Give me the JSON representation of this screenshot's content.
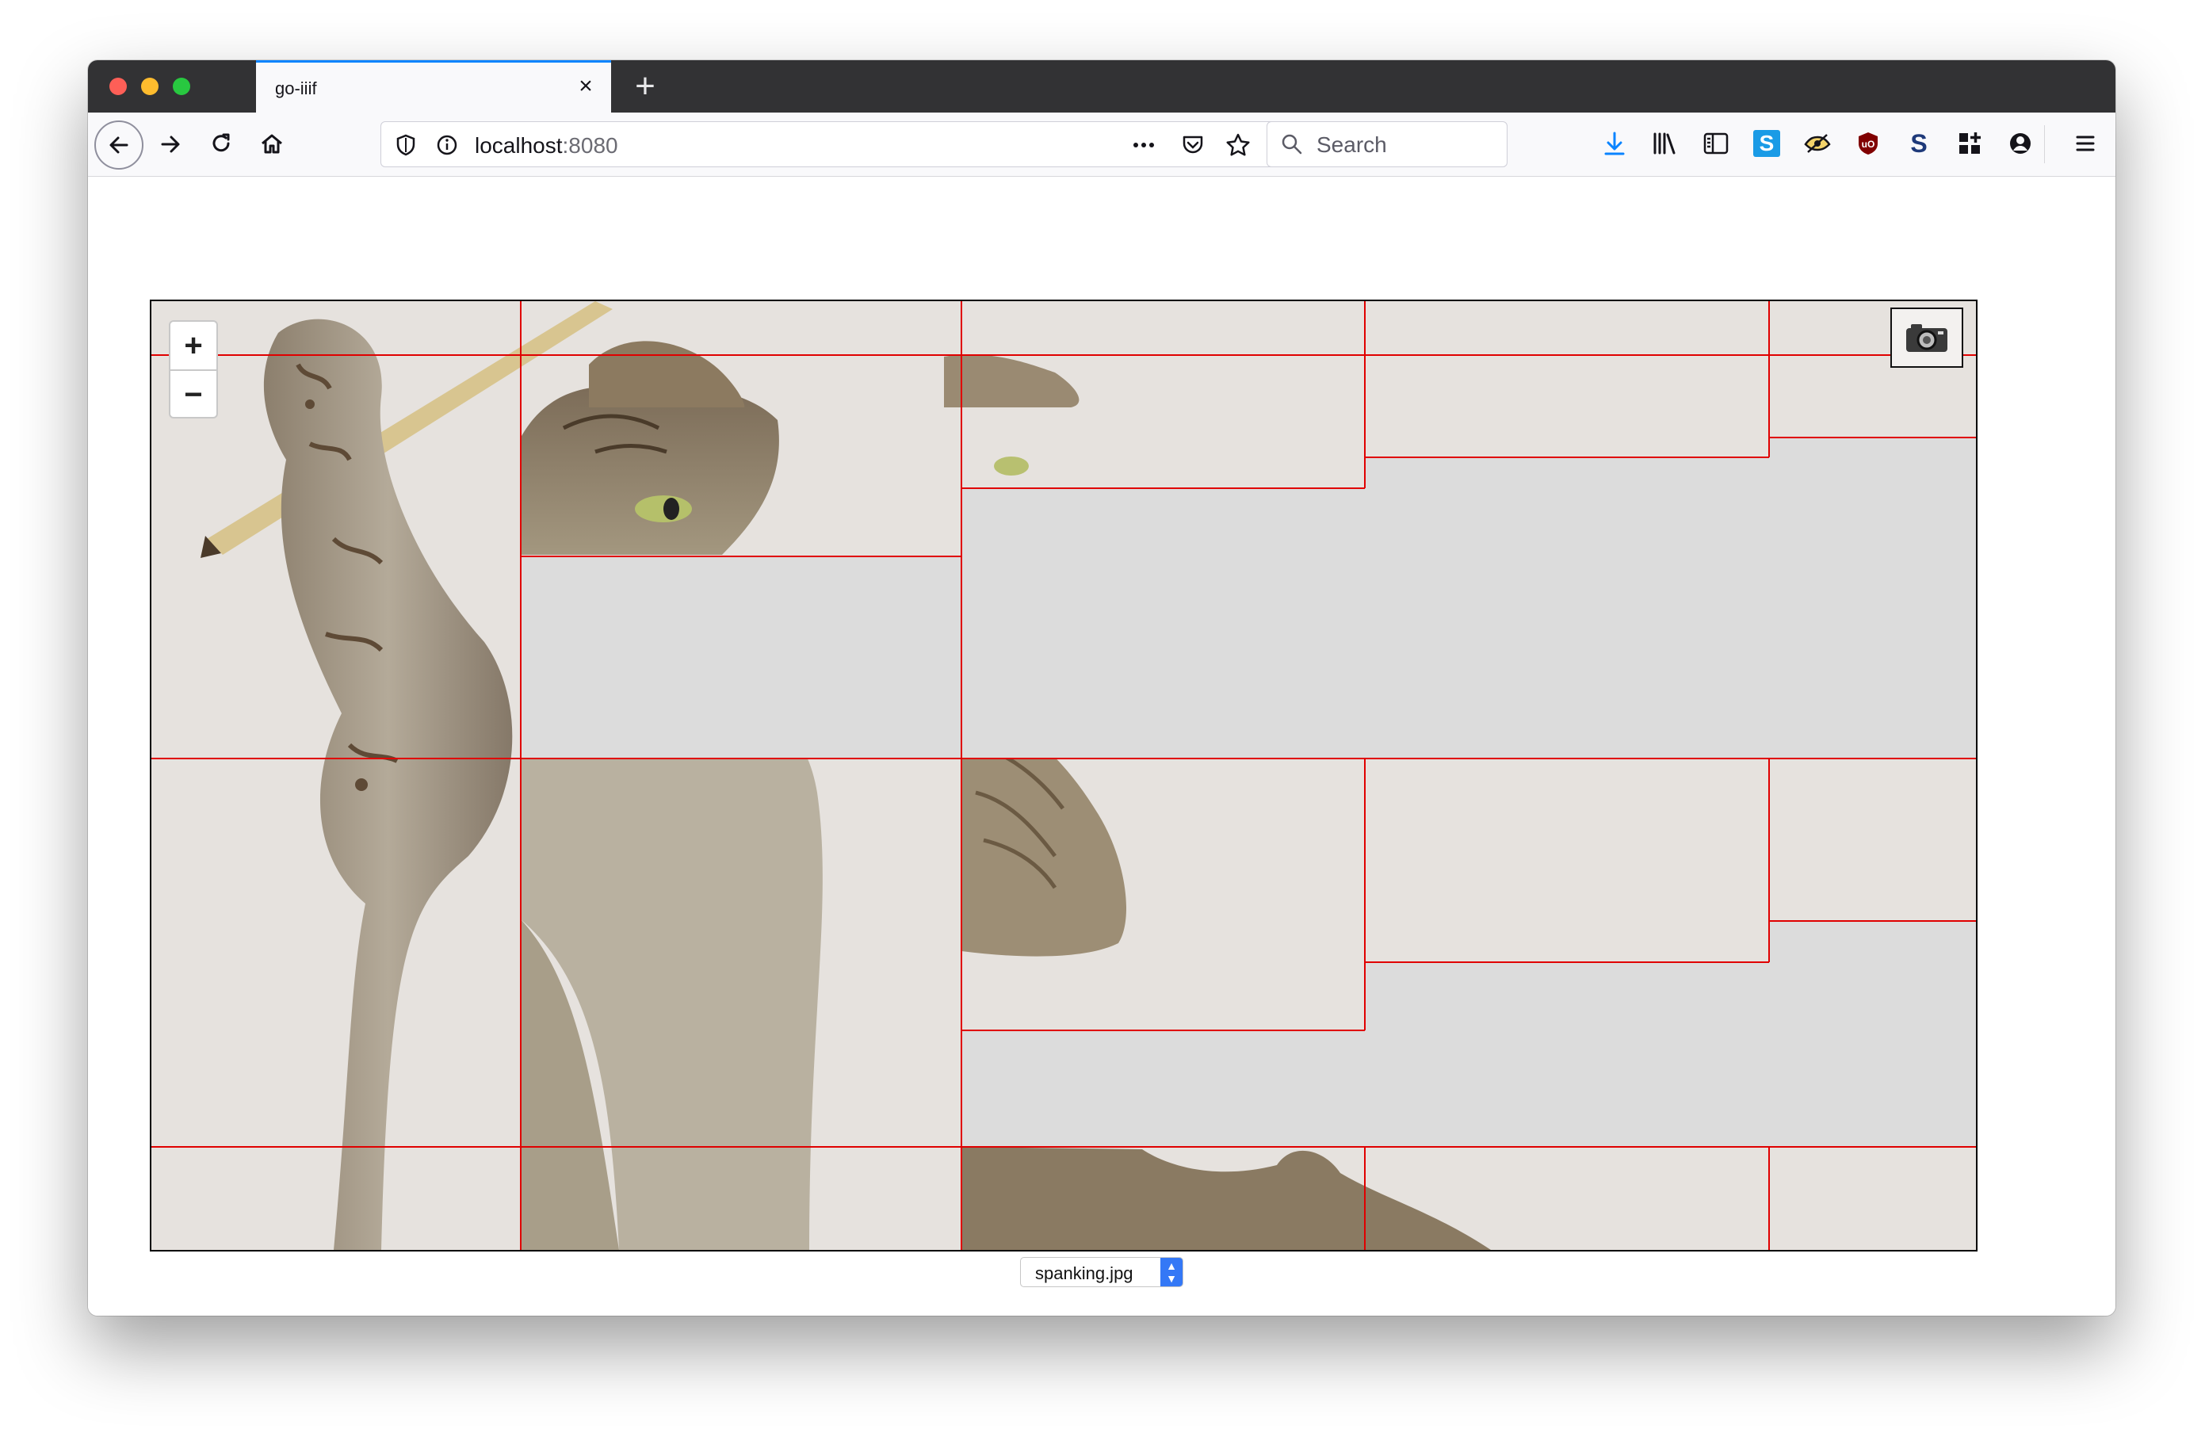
{
  "browser": {
    "tab_title": "go-iiif",
    "url_host": "localhost",
    "url_port": ":8080",
    "search_placeholder": "Search",
    "toolbar_icons": [
      "download-icon",
      "library-icon",
      "sidebar-icon",
      "s-extension-icon",
      "eye-extension-icon",
      "ublock-icon",
      "s-bold-icon",
      "extensions-grid-icon",
      "account-icon",
      "menu-icon"
    ]
  },
  "viewer": {
    "zoom_in_label": "+",
    "zoom_out_label": "−",
    "tile_grid_color": "#e00000",
    "empty_tile_color": "#dcdcdc",
    "image_select_value": "spanking.jpg"
  }
}
